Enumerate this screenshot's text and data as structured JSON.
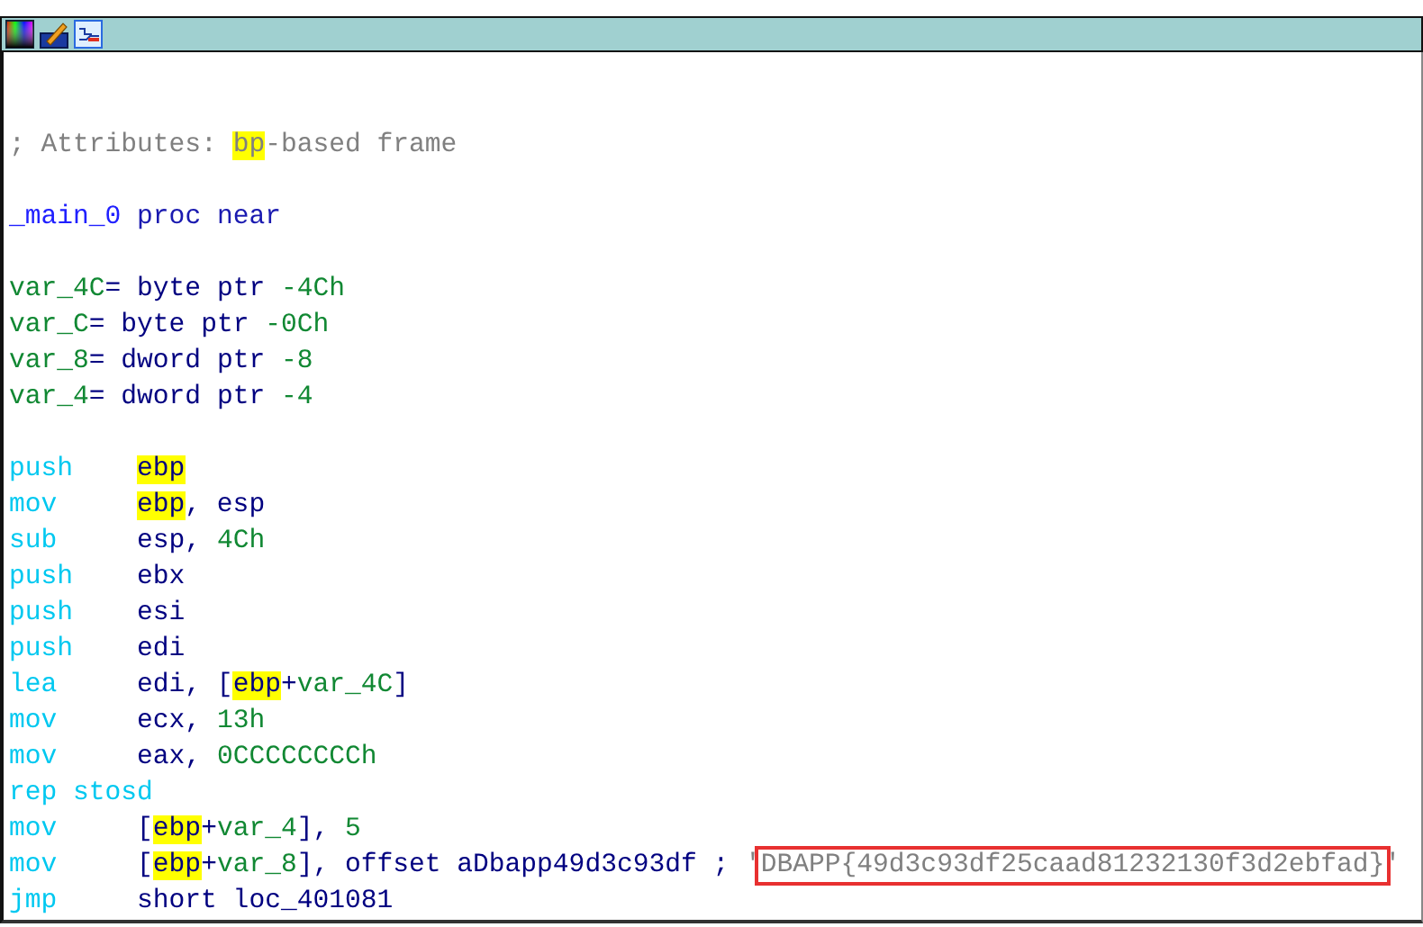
{
  "blocks": [
    {
      "lines": [
        {
          "tokens": [
            {
              "text": "; Attributes: ",
              "kind": "comment"
            },
            {
              "text": "bp",
              "kind": "comment",
              "highlight": true
            },
            {
              "text": "-based frame",
              "kind": "comment"
            }
          ]
        }
      ]
    },
    {
      "lines": [
        {
          "tokens": [
            {
              "text": "_main_0",
              "kind": "proc"
            },
            {
              "text": " proc near",
              "kind": "keyword"
            }
          ]
        }
      ]
    },
    {
      "lines": [
        {
          "tokens": [
            {
              "text": "var_4C",
              "kind": "var"
            },
            {
              "text": "= byte ptr ",
              "kind": "text"
            },
            {
              "text": "-4Ch",
              "kind": "num"
            }
          ]
        },
        {
          "tokens": [
            {
              "text": "var_C",
              "kind": "var"
            },
            {
              "text": "= byte ptr ",
              "kind": "text"
            },
            {
              "text": "-0Ch",
              "kind": "num"
            }
          ]
        },
        {
          "tokens": [
            {
              "text": "var_8",
              "kind": "var"
            },
            {
              "text": "= dword ptr ",
              "kind": "text"
            },
            {
              "text": "-8",
              "kind": "num"
            }
          ]
        },
        {
          "tokens": [
            {
              "text": "var_4",
              "kind": "var"
            },
            {
              "text": "= dword ptr ",
              "kind": "text"
            },
            {
              "text": "-4",
              "kind": "num"
            }
          ]
        }
      ]
    },
    {
      "lines": [
        {
          "mnemonic": "push",
          "tokens": [
            {
              "text": "ebp",
              "kind": "text",
              "highlight": true
            }
          ]
        },
        {
          "mnemonic": "mov",
          "tokens": [
            {
              "text": "ebp",
              "kind": "text",
              "highlight": true
            },
            {
              "text": ", esp",
              "kind": "text"
            }
          ]
        },
        {
          "mnemonic": "sub",
          "tokens": [
            {
              "text": "esp, ",
              "kind": "text"
            },
            {
              "text": "4Ch",
              "kind": "num"
            }
          ]
        },
        {
          "mnemonic": "push",
          "tokens": [
            {
              "text": "ebx",
              "kind": "text"
            }
          ]
        },
        {
          "mnemonic": "push",
          "tokens": [
            {
              "text": "esi",
              "kind": "text"
            }
          ]
        },
        {
          "mnemonic": "push",
          "tokens": [
            {
              "text": "edi",
              "kind": "text"
            }
          ]
        },
        {
          "mnemonic": "lea",
          "tokens": [
            {
              "text": "edi, [",
              "kind": "text"
            },
            {
              "text": "ebp",
              "kind": "text",
              "highlight": true
            },
            {
              "text": "+",
              "kind": "text"
            },
            {
              "text": "var_4C",
              "kind": "var"
            },
            {
              "text": "]",
              "kind": "text"
            }
          ]
        },
        {
          "mnemonic": "mov",
          "tokens": [
            {
              "text": "ecx, ",
              "kind": "text"
            },
            {
              "text": "13h",
              "kind": "num"
            }
          ]
        },
        {
          "mnemonic": "mov",
          "tokens": [
            {
              "text": "eax, ",
              "kind": "text"
            },
            {
              "text": "0CCCCCCCCh",
              "kind": "num"
            }
          ]
        },
        {
          "mnemonic": "rep stosd"
        },
        {
          "mnemonic": "mov",
          "tokens": [
            {
              "text": "[",
              "kind": "text"
            },
            {
              "text": "ebp",
              "kind": "text",
              "highlight": true
            },
            {
              "text": "+",
              "kind": "text"
            },
            {
              "text": "var_4",
              "kind": "var"
            },
            {
              "text": "], ",
              "kind": "text"
            },
            {
              "text": "5",
              "kind": "num"
            }
          ]
        },
        {
          "mnemonic": "mov",
          "tokens": [
            {
              "text": "[",
              "kind": "text"
            },
            {
              "text": "ebp",
              "kind": "text",
              "highlight": true
            },
            {
              "text": "+",
              "kind": "text"
            },
            {
              "text": "var_8",
              "kind": "var"
            },
            {
              "text": "], offset aDbapp49d3c93df ; ",
              "kind": "text"
            },
            {
              "text": "'",
              "kind": "comment"
            },
            {
              "text": "DBAPP{49d3c93df25caad81232130f3d2ebfad}",
              "kind": "comment",
              "boxed": true
            },
            {
              "text": "'",
              "kind": "comment"
            }
          ]
        },
        {
          "mnemonic": "jmp",
          "tokens": [
            {
              "text": "short loc_401081",
              "kind": "text"
            }
          ]
        }
      ]
    }
  ]
}
